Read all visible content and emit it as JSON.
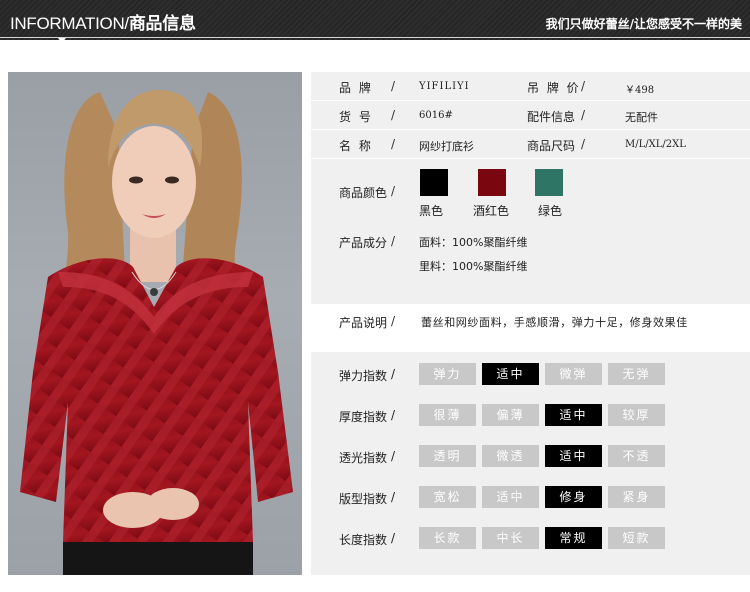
{
  "header": {
    "title_en": "INFORMATION/",
    "title_cn": "商品信息",
    "slogan": "我们只做好蕾丝/让您感受不一样的美"
  },
  "product": {
    "brand_label": "品  牌",
    "brand_value": "YIFILIYI",
    "price_label": "吊 牌 价",
    "price_value": "￥498",
    "sku_label": "货  号",
    "sku_value": "6016#",
    "accessory_label": "配件信息",
    "accessory_value": "无配件",
    "name_label": "名  称",
    "name_value": "网纱打底衫",
    "size_label": "商品尺码",
    "size_value": "M/L/XL/2XL",
    "slash": "/"
  },
  "colors": {
    "label": "商品颜色",
    "items": [
      {
        "name": "黑色",
        "hex": "#000000"
      },
      {
        "name": "酒红色",
        "hex": "#7a0710"
      },
      {
        "name": "绿色",
        "hex": "#2e7566"
      }
    ]
  },
  "composition": {
    "label": "产品成分",
    "lines": [
      "面料：100%聚酯纤维",
      "里料：100%聚酯纤维"
    ]
  },
  "description": {
    "label": "产品说明",
    "text": "蕾丝和网纱面料，手感顺滑，弹力十足，修身效果佳"
  },
  "indices": [
    {
      "label": "弹力指数",
      "options": [
        "弹力",
        "适中",
        "微弹",
        "无弹"
      ],
      "selected": 1
    },
    {
      "label": "厚度指数",
      "options": [
        "很薄",
        "偏薄",
        "适中",
        "较厚"
      ],
      "selected": 2
    },
    {
      "label": "透光指数",
      "options": [
        "透明",
        "微透",
        "适中",
        "不透"
      ],
      "selected": 2
    },
    {
      "label": "版型指数",
      "options": [
        "宽松",
        "适中",
        "修身",
        "紧身"
      ],
      "selected": 2
    },
    {
      "label": "长度指数",
      "options": [
        "长款",
        "中长",
        "常规",
        "短款"
      ],
      "selected": 2
    }
  ],
  "colors_theme": {
    "selected_bg": "#000000",
    "unselected_bg": "#c8c8c8",
    "panel_bg": "#f0f0f0"
  }
}
